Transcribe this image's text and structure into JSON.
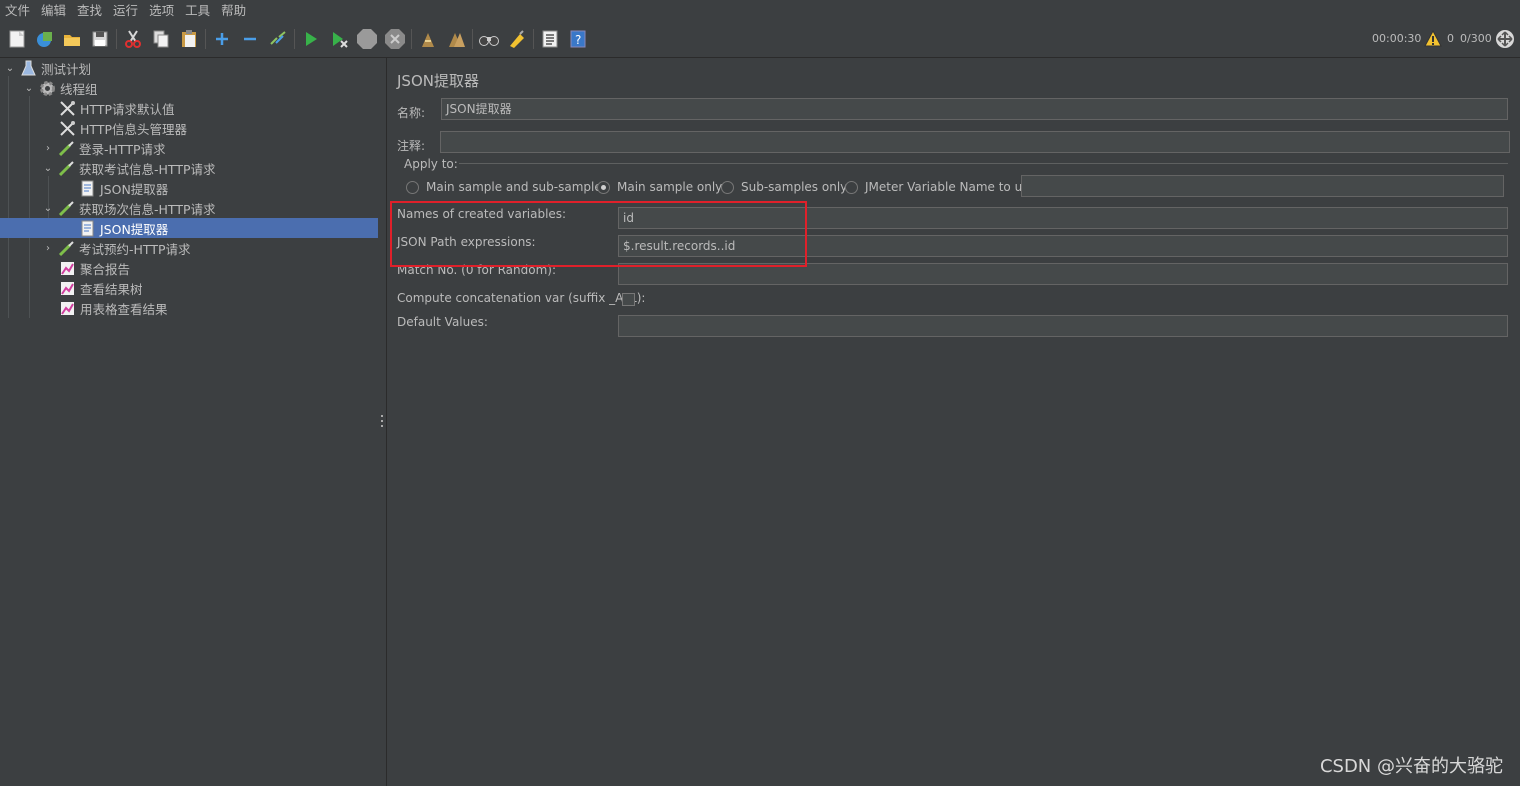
{
  "menu": [
    "文件",
    "编辑",
    "查找",
    "运行",
    "选项",
    "工具",
    "帮助"
  ],
  "toolbar": {
    "timer": "00:00:30",
    "warning_count": "0",
    "threads": "0/300"
  },
  "tree": [
    {
      "label": "测试计划",
      "icon": "flask-icon",
      "level": 0,
      "expanded": true
    },
    {
      "label": "线程组",
      "icon": "gear-icon",
      "level": 1,
      "expanded": true
    },
    {
      "label": "HTTP请求默认值",
      "icon": "tools-icon",
      "level": 2
    },
    {
      "label": "HTTP信息头管理器",
      "icon": "tools-icon",
      "level": 2
    },
    {
      "label": "登录-HTTP请求",
      "icon": "pipette-icon",
      "level": 2,
      "expanded": false
    },
    {
      "label": "获取考试信息-HTTP请求",
      "icon": "pipette-icon",
      "level": 2,
      "expanded": true
    },
    {
      "label": "JSON提取器",
      "icon": "document-icon",
      "level": 3
    },
    {
      "label": "获取场次信息-HTTP请求",
      "icon": "pipette-icon",
      "level": 2,
      "expanded": true
    },
    {
      "label": "JSON提取器",
      "icon": "document-icon",
      "level": 3,
      "selected": true
    },
    {
      "label": "考试预约-HTTP请求",
      "icon": "pipette-icon",
      "level": 2,
      "expanded": false
    },
    {
      "label": "聚合报告",
      "icon": "graph-icon",
      "level": 2
    },
    {
      "label": "查看结果树",
      "icon": "graph-icon",
      "level": 2
    },
    {
      "label": "用表格查看结果",
      "icon": "graph-icon",
      "level": 2
    }
  ],
  "panel": {
    "title": "JSON提取器",
    "name_label": "名称:",
    "name_value": "JSON提取器",
    "comment_label": "注释:",
    "comment_value": "",
    "apply_to_label": "Apply to:",
    "apply_options": [
      {
        "label": "Main sample and sub-samples",
        "selected": false
      },
      {
        "label": "Main sample only",
        "selected": true
      },
      {
        "label": "Sub-samples only",
        "selected": false
      },
      {
        "label": "JMeter Variable Name to use",
        "selected": false
      }
    ],
    "jmeter_var_value": "",
    "names_label": "Names of created variables:",
    "names_value": "id",
    "path_label": "JSON Path expressions:",
    "path_value": "$.result.records..id",
    "match_label": "Match No. (0 for Random):",
    "match_value": "",
    "concat_label": "Compute concatenation var (suffix _ALL):",
    "concat_checked": false,
    "default_label": "Default Values:",
    "default_value": ""
  },
  "watermark": "CSDN @兴奋的大骆驼",
  "colors": {
    "selection": "#4b6eaf",
    "highlight_box": "#e0202a",
    "background": "#3c3f41"
  }
}
